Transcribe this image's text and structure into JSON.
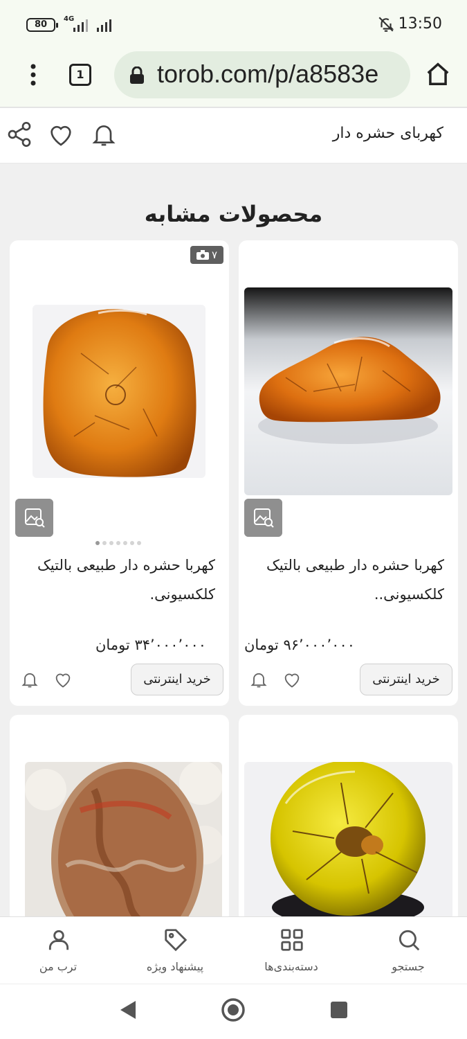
{
  "status_bar": {
    "battery": "80",
    "network": "4G",
    "time": "13:50"
  },
  "browser": {
    "tab_count": "1",
    "url": "torob.com/p/a8583e"
  },
  "header": {
    "title": "کهربای حشره دار"
  },
  "section": {
    "title": "محصولات مشابه"
  },
  "products": [
    {
      "name": "کهربا حشره دار طبیعی بالتیک کلکسیونی..",
      "price": "۹۶٬۰۰۰٬۰۰۰ تومان",
      "buy_label": "خرید اینترنتی"
    },
    {
      "name": "کهربا حشره دار طبیعی بالتیک کلکسیونی.",
      "price": "۳۴٬۰۰۰٬۰۰۰ تومان",
      "buy_label": "خرید اینترنتی",
      "photo_count": "۷"
    },
    {},
    {}
  ],
  "bottom_nav": {
    "items": [
      {
        "label": "جستجو",
        "icon": "search-icon"
      },
      {
        "label": "دسته‌بندی‌ها",
        "icon": "grid-icon"
      },
      {
        "label": "پیشنهاد ویژه",
        "icon": "tag-icon"
      },
      {
        "label": "ترب من",
        "icon": "user-icon"
      }
    ]
  }
}
